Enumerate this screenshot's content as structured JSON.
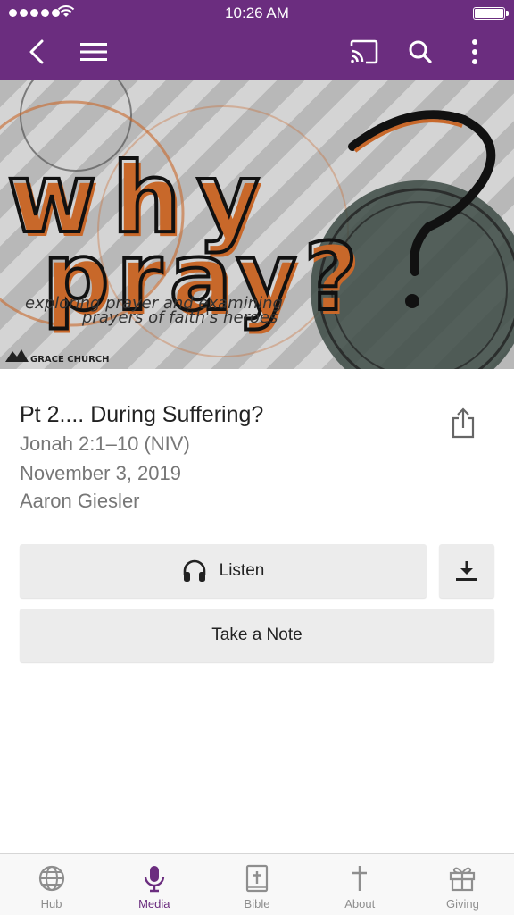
{
  "status_bar": {
    "time": "10:26 AM"
  },
  "header": {
    "background": "#6b2d7f",
    "icons": [
      "back-icon",
      "hamburger-menu-icon",
      "cast-icon",
      "search-icon",
      "more-vertical-icon"
    ]
  },
  "banner": {
    "title_line1": "why",
    "title_line2": "pray?",
    "subtitle_line1": "exploring prayer and examining",
    "subtitle_line2": "prayers of faith's heroes",
    "brand": "GRACE CHURCH"
  },
  "sermon": {
    "title": "Pt 2.... During Suffering?",
    "scripture": "Jonah 2:1–10 (NIV)",
    "date": "November 3, 2019",
    "speaker": "Aaron Giesler"
  },
  "actions": {
    "listen_label": "Listen",
    "note_label": "Take a Note"
  },
  "tabs": [
    {
      "label": "Hub",
      "icon": "globe-icon",
      "active": false
    },
    {
      "label": "Media",
      "icon": "microphone-icon",
      "active": true
    },
    {
      "label": "Bible",
      "icon": "bible-icon",
      "active": false
    },
    {
      "label": "About",
      "icon": "cross-icon",
      "active": false
    },
    {
      "label": "Giving",
      "icon": "gift-icon",
      "active": false
    }
  ],
  "colors": {
    "accent": "#6b2d7f",
    "banner_orange": "#c8682a",
    "secondary_text": "#777777"
  }
}
